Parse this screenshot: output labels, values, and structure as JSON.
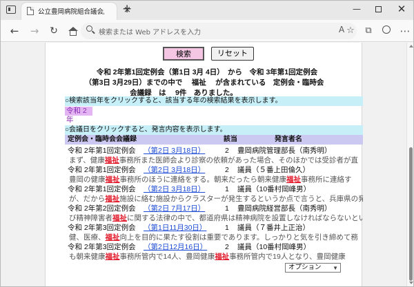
{
  "browser": {
    "tab_title": "公立豊岡病院組合議会/会議録検索",
    "tab_close": "×",
    "new_tab": "+",
    "address_placeholder": "検索または Web アドレスを入力",
    "window_min": "—",
    "window_close": "✕",
    "back": "←",
    "forward": "→",
    "refresh": "↻",
    "reading_view": "A",
    "favorites": "☆",
    "collections": "⧉",
    "more": "⋯"
  },
  "buttons": {
    "search": "検索",
    "reset": "リセット"
  },
  "summary": {
    "line1": "令和 2年第1回定例会（第1日 3月 4日）　から　令和 3年第1回定例会",
    "line2": "（第3日 3月29日）までの中で　 福祉　 が含まれている　定例会・臨時会",
    "line3": "会議録　は　 9件　ありました。"
  },
  "year_hint": "○検索該当年をクリックすると、該当する年の検索結果を表示します。",
  "year_item": "令和 2年",
  "day_hint": "○会議日をクリックすると、発言内容を表示します。",
  "table": {
    "headers": [
      "定例会・臨時会会議録",
      "該当",
      "発言者名"
    ],
    "rows": [
      {
        "session": "令和 2年第1回定例会",
        "day": "（第2日 3月18日）",
        "count": "2",
        "speaker": "豊岡病院管理部長（南秀明）",
        "excerpt_pre": "まず、健康",
        "excerpt_hl": "福祉",
        "excerpt_post": "事務所また医師会より診察の依頼があった場合、そのほかでは受診者が直"
      },
      {
        "session": "令和 2年第1回定例会",
        "day": "（第2日 3月18日）",
        "count": "2",
        "speaker": "議員（５番上田倫久）",
        "excerpt_pre": "豊岡の健康",
        "excerpt_hl": "福祉",
        "excerpt_post": "事務所のほうに連絡をする。朝来だったら朝来健康",
        "excerpt_hl2": "福祉",
        "excerpt_post2": "事務所に連絡す"
      },
      {
        "session": "令和 2年第1回定例会",
        "day": "（第2日 3月18日）",
        "count": "1",
        "speaker": "議員（10番村岡峰男）",
        "excerpt_pre": "が、だから",
        "excerpt_hl": "福祉",
        "excerpt_post": "施設に絡む施設からクラスターが発生するというか点で言うと、兵庫県の発生"
      },
      {
        "session": "令和 2年第2回定例会",
        "day": "（第2日 7月17日）",
        "count": "1",
        "speaker": "豊岡病院経営部長（南秀明）",
        "excerpt_pre": "び精神障害者",
        "excerpt_hl": "福祉",
        "excerpt_post": "に関する法律の中で、都道府県は精神病院を設置しなければならないとい"
      },
      {
        "session": "令和 2年第3回定例会",
        "day": "（第1日11月30日）",
        "count": "1",
        "speaker": "議員（７番井上正治）",
        "excerpt_pre": "健、医療、",
        "excerpt_hl": "福祉",
        "excerpt_post": "向上を目的に果たす役割は重要であります。しっかりと気を引き締めて務"
      },
      {
        "session": "令和 2年第3回定例会",
        "day": "（第2日12月16日）",
        "count": "2",
        "speaker": "議員（10番村岡峰男）",
        "excerpt_pre": "も朝来健康",
        "excerpt_hl": "福祉",
        "excerpt_post": "事務所管内で14人、豊岡健康",
        "excerpt_hl2": "福祉",
        "excerpt_post2": "事務所管内で19人となり、豊岡健康"
      }
    ]
  },
  "options_select": "オプション",
  "colors": {
    "hint_bg": "#c7eff7",
    "year_bg": "#e4b5f3",
    "header_bg": "#cbc9f2",
    "search_btn_bg": "#f5c6e4",
    "highlight": "#e21c2c",
    "link": "#1a49d6"
  }
}
